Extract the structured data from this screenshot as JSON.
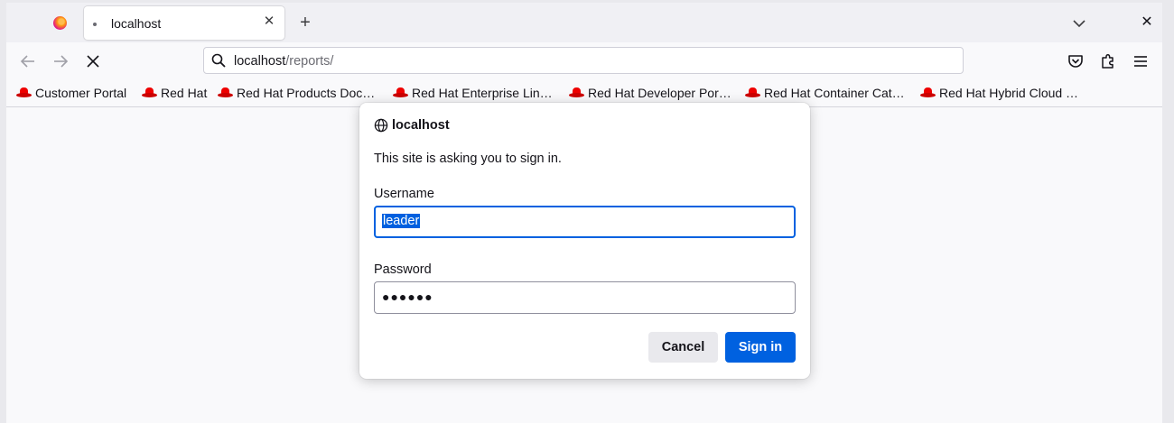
{
  "tabs": [
    {
      "title": "localhost",
      "close_glyph": "✕"
    }
  ],
  "tabbar": {
    "new_tab_glyph": "+",
    "window_close_glyph": "✕"
  },
  "nav": {
    "reload_state": "stop-loading-icon"
  },
  "urlbar": {
    "host": "localhost",
    "path": "/reports/"
  },
  "bookmarks": [
    {
      "label": "Customer Portal"
    },
    {
      "label": "Red Hat"
    },
    {
      "label": "Red Hat Products Doc…"
    },
    {
      "label": "Red Hat Enterprise Lin…"
    },
    {
      "label": "Red Hat Developer Por…"
    },
    {
      "label": "Red Hat Container Cat…"
    },
    {
      "label": "Red Hat Hybrid Cloud …"
    }
  ],
  "dialog": {
    "host": "localhost",
    "message": "This site is asking you to sign in.",
    "username_label": "Username",
    "username_value": "leader",
    "password_label": "Password",
    "password_mask": "●●●●●●",
    "cancel_label": "Cancel",
    "signin_label": "Sign in"
  },
  "colors": {
    "accent": "#0061e0",
    "bookmark_icon": "#e00000"
  }
}
